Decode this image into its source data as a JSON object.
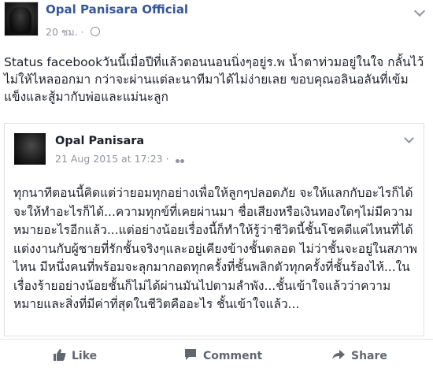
{
  "post": {
    "author": "Opal Panisara Official",
    "time": "20 ชม.",
    "separator": "·",
    "status_text": "Status facebookวันนี้เมื่อปีที่แล้วตอนนอนนิ่งๆอยู่ร.พ น้ำตาท่วมอยู่ในใจ กลั้นไว้ไม่ให้ไหลออกมา กว่าจะผ่านแต่ละนาทีมาได้ไม่ง่ายเลย ขอบคุณอลินอลันที่เข้มแข็งและสู้มากับพ่อและแม่นะลูก"
  },
  "shared": {
    "author": "Opal Panisara",
    "date": "21 Aug 2015 at 17:23",
    "separator": "·",
    "text": "ทุกนาทีตอนนี้คิดแต่ว่ายอมทุกอย่างเพื่อให้ลูกๆปลอดภัย จะให้แลกกับอะไรก็ได้ จะให้ทำอะไรก็ได้...ความทุกข์ที่เคยผ่านมา ชื่อเสียงหรือเงินทองใดๆไม่มีความหมายอะไรอีกแล้ว...แต่อย่างน้อยเรื่องนี้ก็ทำให้รู้ว่าชีวิตนี้ชั้นโชคดีแค่ไหนที่ได้แต่งงานกับผู้ชายที่รักชั้นจริงๆและอยู่เคียงข้างชั้นตลอด ไม่ว่าชั้นจะอยู่ในสภาพไหน มีหนึ่งคนที่พร้อมจะลุกมากอดทุกครั้งที่ชั้นพลิกตัวทุกครั้งที่ชั้นร้องไห้...ในเรื่องร้ายอย่างน้อยชั้นก็ไม่ได้ผ่านมันไปตามลำพัง...ชั้นเข้าใจแล้วว่าความหมายและสิ่งที่มีค่าที่สุดในชีวิตคืออะไร ชั้นเข้าใจแล้ว..."
  },
  "actions": {
    "like": "Like",
    "comment": "Comment",
    "share": "Share"
  },
  "colors": {
    "author_link": "#365899",
    "meta_gray": "#90949c",
    "action_gray": "#606770"
  },
  "icons": [
    "globe-icon",
    "chevron-down-icon",
    "friends-icon",
    "like-icon",
    "comment-icon",
    "share-icon"
  ]
}
